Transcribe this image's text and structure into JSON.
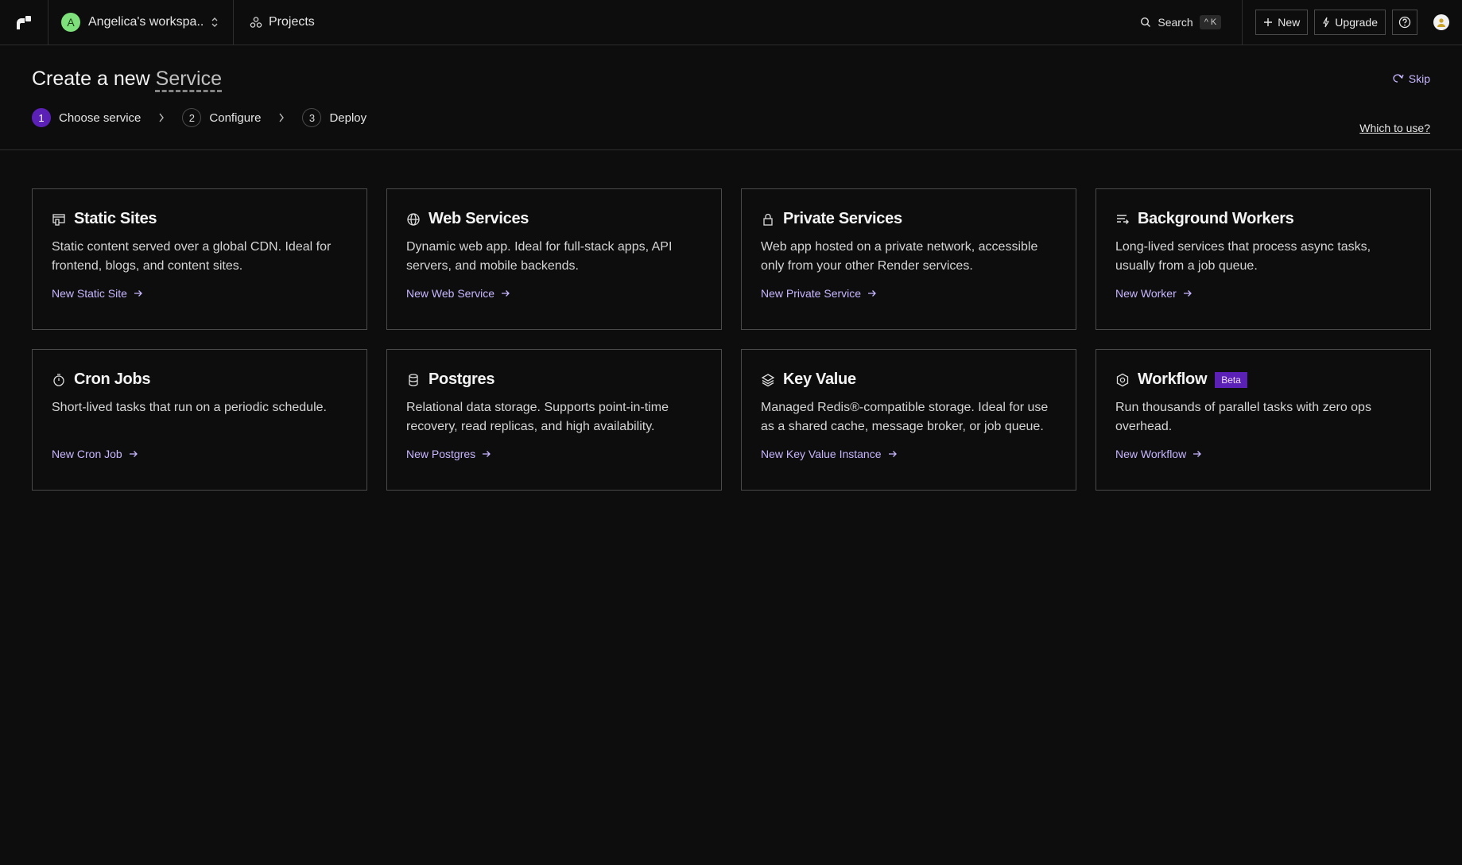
{
  "topbar": {
    "workspace_initial": "A",
    "workspace_name": "Angelica's workspa...",
    "projects_label": "Projects",
    "search_label": "Search",
    "search_shortcut": "^ K",
    "new_label": "New",
    "upgrade_label": "Upgrade"
  },
  "header": {
    "title_prefix": "Create a new",
    "title_entity": "Service",
    "skip_label": "Skip",
    "which_label": "Which to use?"
  },
  "steps": [
    {
      "num": "1",
      "label": "Choose service",
      "active": true
    },
    {
      "num": "2",
      "label": "Configure",
      "active": false
    },
    {
      "num": "3",
      "label": "Deploy",
      "active": false
    }
  ],
  "cards": [
    {
      "icon": "static-site-icon",
      "title": "Static Sites",
      "desc": "Static content served over a global CDN. Ideal for frontend, blogs, and content sites.",
      "link": "New Static Site"
    },
    {
      "icon": "globe-icon",
      "title": "Web Services",
      "desc": "Dynamic web app. Ideal for full-stack apps, API servers, and mobile backends.",
      "link": "New Web Service"
    },
    {
      "icon": "lock-icon",
      "title": "Private Services",
      "desc": "Web app hosted on a private network, accessible only from your other Render services.",
      "link": "New Private Service"
    },
    {
      "icon": "queue-icon",
      "title": "Background Workers",
      "desc": "Long-lived services that process async tasks, usually from a job queue.",
      "link": "New Worker"
    },
    {
      "icon": "timer-icon",
      "title": "Cron Jobs",
      "desc": "Short-lived tasks that run on a periodic schedule.",
      "link": "New Cron Job"
    },
    {
      "icon": "database-icon",
      "title": "Postgres",
      "desc": "Relational data storage. Supports point-in-time recovery, read replicas, and high availability.",
      "link": "New Postgres"
    },
    {
      "icon": "layers-icon",
      "title": "Key Value",
      "desc": "Managed Redis®-compatible storage. Ideal for use as a shared cache, message broker, or job queue.",
      "link": "New Key Value Instance"
    },
    {
      "icon": "workflow-icon",
      "title": "Workflow",
      "badge": "Beta",
      "desc": "Run thousands of parallel tasks with zero ops overhead.",
      "link": "New Workflow"
    }
  ],
  "colors": {
    "background": "#0d0d0d",
    "border": "#4a4a4a",
    "accent": "#5b21b6",
    "link": "#c8b6ff"
  }
}
